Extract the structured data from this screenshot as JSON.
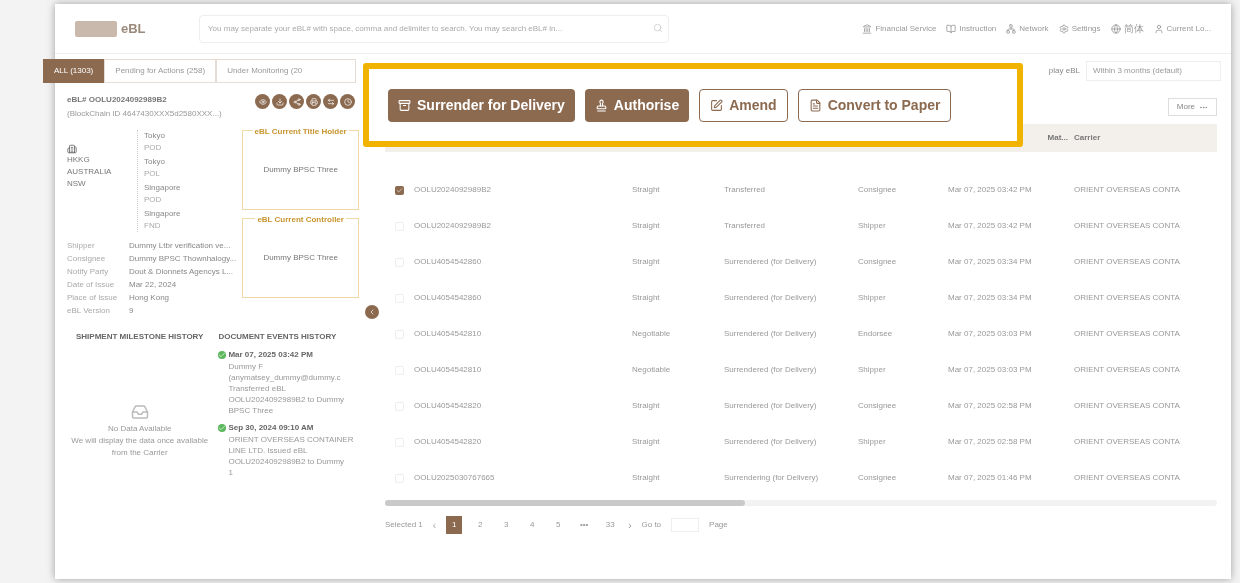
{
  "header": {
    "logo": "eBL",
    "search": {
      "placeholder": "You may separate your eBL# with space, comma and delimiter to search. You may search eBL# in..."
    },
    "nav": [
      {
        "kind": "finance",
        "label": "Financial Service"
      },
      {
        "kind": "book",
        "label": "Instruction"
      },
      {
        "kind": "network",
        "label": "Network"
      },
      {
        "kind": "settings",
        "label": "Settings"
      },
      {
        "kind": "globe",
        "label": "简体"
      },
      {
        "kind": "user",
        "label": "Current Lo..."
      }
    ]
  },
  "tabs": [
    {
      "label": "ALL (1303)",
      "selected": true
    },
    {
      "label": "Pending for Actions (258)",
      "selected": false
    },
    {
      "label": "Under Monitoring (20",
      "selected": false
    }
  ],
  "filter": {
    "label": "play eBL",
    "value": "Within 3 months (default)"
  },
  "detail": {
    "title": "eBL# OOLU2024092989B2",
    "subtitle": "(BlockChain ID 4647430XXX5d2580XXX...)",
    "place": [
      "HKKG",
      "AUSTRALIA",
      "NSW"
    ],
    "route": [
      {
        "city": "Tokyo",
        "code": "POD"
      },
      {
        "city": "Tokyo",
        "code": "POL"
      },
      {
        "city": "Singapore",
        "code": "POD"
      },
      {
        "city": "Singapore",
        "code": "FND"
      }
    ],
    "fields": [
      {
        "label": "Shipper",
        "value": "Dummy Ltbr verification ve..."
      },
      {
        "label": "Consignee",
        "value": "Dummy BPSC Thownhalogy..."
      },
      {
        "label": "Notify Party",
        "value": "Dout & Dionnets Agencys L..."
      },
      {
        "label": "Date of Issue",
        "value": "Mar 22, 2024"
      },
      {
        "label": "Place of Issue",
        "value": "Hong Kong"
      },
      {
        "label": "eBL Version",
        "value": "9"
      }
    ],
    "holder": {
      "title": "eBL Current Title Holder",
      "value": "Dummy BPSC Three"
    },
    "controller": {
      "title": "eBL Current Controller",
      "value": "Dummy BPSC Three"
    },
    "milestones": {
      "title": "SHIPMENT MILESTONE HISTORY",
      "empty": "No Data Available",
      "note": "We will display the data once available from the Carrier"
    },
    "events": {
      "title": "DOCUMENT EVENTS HISTORY",
      "items": [
        {
          "time": "Mar 07, 2025 03:42 PM",
          "lines": [
            "Dummy F",
            "(anymatsey_dummy@dummy.c",
            "Transferred eBL",
            "OOLU2024092989B2 to Dummy",
            "BPSC Three"
          ]
        },
        {
          "time": "Sep 30, 2024 09:10 AM",
          "lines": [
            "ORIENT OVERSEAS CONTAINER",
            "LINE LTD. Issued eBL",
            "OOLU2024092989B2 to Dummy",
            "1"
          ]
        }
      ]
    }
  },
  "actions": [
    {
      "kind": "primary",
      "label": "Surrender for Delivery"
    },
    {
      "kind": "primary",
      "label": "Authorise"
    },
    {
      "kind": "outline",
      "label": "Amend"
    },
    {
      "kind": "outline",
      "label": "Convert to Paper"
    }
  ],
  "more": "More",
  "table": {
    "columns": [
      "",
      "",
      "",
      "",
      "Mat...",
      "Carrier"
    ],
    "rows": [
      {
        "selected": true,
        "cells": [
          "OOLU2024092989B2",
          "Straight",
          "Transferred",
          "Consignee",
          "Mar 07, 2025 03:42 PM",
          "ORIENT OVERSEAS CONTA"
        ]
      },
      {
        "selected": false,
        "cells": [
          "OOLU2024092989B2",
          "Straight",
          "Transferred",
          "Shipper",
          "Mar 07, 2025 03:42 PM",
          "ORIENT OVERSEAS CONTA"
        ]
      },
      {
        "selected": false,
        "cells": [
          "OOLU4054542860",
          "Straight",
          "Surrendered (for Delivery)",
          "Consignee",
          "Mar 07, 2025 03:34 PM",
          "ORIENT OVERSEAS CONTA"
        ]
      },
      {
        "selected": false,
        "cells": [
          "OOLU4054542860",
          "Straight",
          "Surrendered (for Delivery)",
          "Shipper",
          "Mar 07, 2025 03:34 PM",
          "ORIENT OVERSEAS CONTA"
        ]
      },
      {
        "selected": false,
        "cells": [
          "OOLU4054542810",
          "Negotiable",
          "Surrendered (for Delivery)",
          "Endorsee",
          "Mar 07, 2025 03:03 PM",
          "ORIENT OVERSEAS CONTA"
        ]
      },
      {
        "selected": false,
        "cells": [
          "OOLU4054542810",
          "Negotiable",
          "Surrendered (for Delivery)",
          "Shipper",
          "Mar 07, 2025 03:03 PM",
          "ORIENT OVERSEAS CONTA"
        ]
      },
      {
        "selected": false,
        "cells": [
          "OOLU4054542820",
          "Straight",
          "Surrendered (for Delivery)",
          "Consignee",
          "Mar 07, 2025 02:58 PM",
          "ORIENT OVERSEAS CONTA"
        ]
      },
      {
        "selected": false,
        "cells": [
          "OOLU4054542820",
          "Straight",
          "Surrendered (for Delivery)",
          "Shipper",
          "Mar 07, 2025 02:58 PM",
          "ORIENT OVERSEAS CONTA"
        ]
      },
      {
        "selected": false,
        "cells": [
          "OOLU2025030767665",
          "Straight",
          "Surrendering (for Delivery)",
          "Consignee",
          "Mar 07, 2025 01:46 PM",
          "ORIENT OVERSEAS CONTA"
        ]
      }
    ]
  },
  "pagination": {
    "selected_text": "Selected 1",
    "prev": "‹",
    "pages": [
      {
        "label": "1",
        "selected": true
      },
      {
        "label": "2",
        "selected": false
      },
      {
        "label": "3",
        "selected": false
      },
      {
        "label": "4",
        "selected": false
      },
      {
        "label": "5",
        "selected": false
      },
      {
        "label": "•••",
        "selected": false
      },
      {
        "label": "33",
        "selected": false
      }
    ],
    "next": "›",
    "goto": "Go to",
    "page": "Page"
  }
}
